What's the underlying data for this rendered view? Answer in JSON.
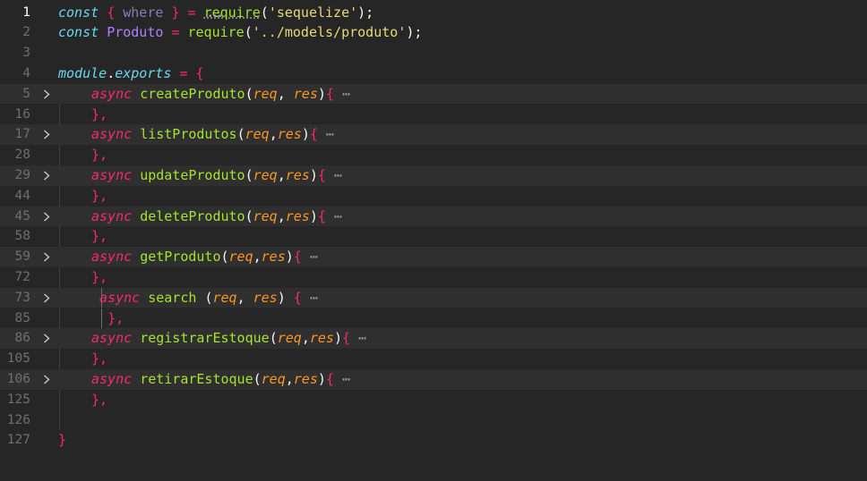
{
  "editor": {
    "lines": [
      {
        "num": "1",
        "current": true,
        "fold": false,
        "indent": 0,
        "tokens": [
          {
            "t": "const",
            "c": "t-kw"
          },
          {
            "t": " ",
            "c": "t-plain"
          },
          {
            "t": "{",
            "c": "t-brace"
          },
          {
            "t": " ",
            "c": "t-plain"
          },
          {
            "t": "where",
            "c": "t-faded"
          },
          {
            "t": " ",
            "c": "t-plain"
          },
          {
            "t": "}",
            "c": "t-brace"
          },
          {
            "t": " ",
            "c": "t-plain"
          },
          {
            "t": "=",
            "c": "t-punc"
          },
          {
            "t": " ",
            "c": "t-plain"
          },
          {
            "t": "require",
            "c": "t-fn"
          },
          {
            "t": "(",
            "c": "t-paren"
          },
          {
            "t": "'",
            "c": "t-str"
          },
          {
            "t": "sequelize",
            "c": "t-str"
          },
          {
            "t": "'",
            "c": "t-str"
          },
          {
            "t": ");",
            "c": "t-paren"
          }
        ]
      },
      {
        "num": "2",
        "fold": false,
        "indent": 0,
        "tokens": [
          {
            "t": "const",
            "c": "t-kw"
          },
          {
            "t": " ",
            "c": "t-plain"
          },
          {
            "t": "Produto",
            "c": "t-var"
          },
          {
            "t": " ",
            "c": "t-plain"
          },
          {
            "t": "=",
            "c": "t-punc"
          },
          {
            "t": " ",
            "c": "t-plain"
          },
          {
            "t": "require",
            "c": "t-fn"
          },
          {
            "t": "(",
            "c": "t-paren"
          },
          {
            "t": "'",
            "c": "t-str"
          },
          {
            "t": "../models/produto",
            "c": "t-str"
          },
          {
            "t": "'",
            "c": "t-str"
          },
          {
            "t": ");",
            "c": "t-paren"
          }
        ]
      },
      {
        "num": "3",
        "fold": false,
        "indent": 0,
        "tokens": []
      },
      {
        "num": "4",
        "fold": false,
        "indent": 0,
        "tokens": [
          {
            "t": "module",
            "c": "t-mod"
          },
          {
            "t": ".",
            "c": "t-plain"
          },
          {
            "t": "exports",
            "c": "t-prop"
          },
          {
            "t": " ",
            "c": "t-plain"
          },
          {
            "t": "=",
            "c": "t-punc"
          },
          {
            "t": " ",
            "c": "t-plain"
          },
          {
            "t": "{",
            "c": "t-brace"
          }
        ]
      },
      {
        "num": "5",
        "fold": true,
        "indent": 1,
        "tokens": [
          {
            "t": "async",
            "c": "t-async"
          },
          {
            "t": " ",
            "c": "t-plain"
          },
          {
            "t": "createProduto",
            "c": "t-fn"
          },
          {
            "t": "(",
            "c": "t-paren"
          },
          {
            "t": "req",
            "c": "t-param"
          },
          {
            "t": ", ",
            "c": "t-plain"
          },
          {
            "t": "res",
            "c": "t-param"
          },
          {
            "t": ")",
            "c": "t-paren"
          },
          {
            "t": "{",
            "c": "t-brace"
          },
          {
            "t": " ⋯",
            "c": "t-ellipsis"
          }
        ]
      },
      {
        "num": "16",
        "fold": false,
        "indent": 1,
        "tokens": [
          {
            "t": "},",
            "c": "t-brace"
          }
        ]
      },
      {
        "num": "17",
        "fold": true,
        "indent": 1,
        "tokens": [
          {
            "t": "async",
            "c": "t-async"
          },
          {
            "t": " ",
            "c": "t-plain"
          },
          {
            "t": "listProdutos",
            "c": "t-fn"
          },
          {
            "t": "(",
            "c": "t-paren"
          },
          {
            "t": "req",
            "c": "t-param"
          },
          {
            "t": ",",
            "c": "t-plain"
          },
          {
            "t": "res",
            "c": "t-param"
          },
          {
            "t": ")",
            "c": "t-paren"
          },
          {
            "t": "{",
            "c": "t-brace"
          },
          {
            "t": " ⋯",
            "c": "t-ellipsis"
          }
        ]
      },
      {
        "num": "28",
        "fold": false,
        "indent": 1,
        "tokens": [
          {
            "t": "},",
            "c": "t-brace"
          }
        ]
      },
      {
        "num": "29",
        "fold": true,
        "indent": 1,
        "tokens": [
          {
            "t": "async",
            "c": "t-async"
          },
          {
            "t": " ",
            "c": "t-plain"
          },
          {
            "t": "updateProduto",
            "c": "t-fn"
          },
          {
            "t": "(",
            "c": "t-paren"
          },
          {
            "t": "req",
            "c": "t-param"
          },
          {
            "t": ",",
            "c": "t-plain"
          },
          {
            "t": "res",
            "c": "t-param"
          },
          {
            "t": ")",
            "c": "t-paren"
          },
          {
            "t": "{",
            "c": "t-brace"
          },
          {
            "t": " ⋯",
            "c": "t-ellipsis"
          }
        ]
      },
      {
        "num": "44",
        "fold": false,
        "indent": 1,
        "tokens": [
          {
            "t": "},",
            "c": "t-brace"
          }
        ]
      },
      {
        "num": "45",
        "fold": true,
        "indent": 1,
        "tokens": [
          {
            "t": "async",
            "c": "t-async"
          },
          {
            "t": " ",
            "c": "t-plain"
          },
          {
            "t": "deleteProduto",
            "c": "t-fn"
          },
          {
            "t": "(",
            "c": "t-paren"
          },
          {
            "t": "req",
            "c": "t-param"
          },
          {
            "t": ",",
            "c": "t-plain"
          },
          {
            "t": "res",
            "c": "t-param"
          },
          {
            "t": ")",
            "c": "t-paren"
          },
          {
            "t": "{",
            "c": "t-brace"
          },
          {
            "t": " ⋯",
            "c": "t-ellipsis"
          }
        ]
      },
      {
        "num": "58",
        "fold": false,
        "indent": 1,
        "tokens": [
          {
            "t": "},",
            "c": "t-brace"
          }
        ]
      },
      {
        "num": "59",
        "fold": true,
        "indent": 1,
        "tokens": [
          {
            "t": "async",
            "c": "t-async"
          },
          {
            "t": " ",
            "c": "t-plain"
          },
          {
            "t": "getProduto",
            "c": "t-fn"
          },
          {
            "t": "(",
            "c": "t-paren"
          },
          {
            "t": "req",
            "c": "t-param"
          },
          {
            "t": ",",
            "c": "t-plain"
          },
          {
            "t": "res",
            "c": "t-param"
          },
          {
            "t": ")",
            "c": "t-paren"
          },
          {
            "t": "{",
            "c": "t-brace"
          },
          {
            "t": " ⋯",
            "c": "t-ellipsis"
          }
        ]
      },
      {
        "num": "72",
        "fold": false,
        "indent": 1,
        "tokens": [
          {
            "t": "},",
            "c": "t-brace"
          }
        ]
      },
      {
        "num": "73",
        "fold": true,
        "indent": 1,
        "extra": true,
        "tokens": [
          {
            "t": " ",
            "c": "t-plain"
          },
          {
            "t": "async",
            "c": "t-async"
          },
          {
            "t": " ",
            "c": "t-plain"
          },
          {
            "t": "search",
            "c": "t-fn"
          },
          {
            "t": " ",
            "c": "t-plain"
          },
          {
            "t": "(",
            "c": "t-paren"
          },
          {
            "t": "req",
            "c": "t-param"
          },
          {
            "t": ", ",
            "c": "t-plain"
          },
          {
            "t": "res",
            "c": "t-param"
          },
          {
            "t": ")",
            "c": "t-paren"
          },
          {
            "t": " ",
            "c": "t-plain"
          },
          {
            "t": "{",
            "c": "t-brace"
          },
          {
            "t": " ⋯",
            "c": "t-ellipsis"
          }
        ]
      },
      {
        "num": "85",
        "fold": false,
        "indent": 1,
        "extra": true,
        "tokens": [
          {
            "t": "  ",
            "c": "t-plain"
          },
          {
            "t": "},",
            "c": "t-brace"
          }
        ]
      },
      {
        "num": "86",
        "fold": true,
        "indent": 1,
        "tokens": [
          {
            "t": "async",
            "c": "t-async"
          },
          {
            "t": " ",
            "c": "t-plain"
          },
          {
            "t": "registrarEstoque",
            "c": "t-fn"
          },
          {
            "t": "(",
            "c": "t-paren"
          },
          {
            "t": "req",
            "c": "t-param"
          },
          {
            "t": ",",
            "c": "t-plain"
          },
          {
            "t": "res",
            "c": "t-param"
          },
          {
            "t": ")",
            "c": "t-paren"
          },
          {
            "t": "{",
            "c": "t-brace"
          },
          {
            "t": " ⋯",
            "c": "t-ellipsis"
          }
        ]
      },
      {
        "num": "105",
        "fold": false,
        "indent": 1,
        "tokens": [
          {
            "t": "},",
            "c": "t-brace"
          }
        ]
      },
      {
        "num": "106",
        "fold": true,
        "indent": 1,
        "tokens": [
          {
            "t": "async",
            "c": "t-async"
          },
          {
            "t": " ",
            "c": "t-plain"
          },
          {
            "t": "retirarEstoque",
            "c": "t-fn"
          },
          {
            "t": "(",
            "c": "t-paren"
          },
          {
            "t": "req",
            "c": "t-param"
          },
          {
            "t": ",",
            "c": "t-plain"
          },
          {
            "t": "res",
            "c": "t-param"
          },
          {
            "t": ")",
            "c": "t-paren"
          },
          {
            "t": "{",
            "c": "t-brace"
          },
          {
            "t": " ⋯",
            "c": "t-ellipsis"
          }
        ]
      },
      {
        "num": "125",
        "fold": false,
        "indent": 1,
        "tokens": [
          {
            "t": "},",
            "c": "t-brace"
          }
        ]
      },
      {
        "num": "126",
        "fold": false,
        "indent": 0,
        "tokens": []
      },
      {
        "num": "127",
        "fold": false,
        "indent": 0,
        "tokens": [
          {
            "t": "}",
            "c": "t-brace"
          }
        ]
      }
    ],
    "fold_icon": "chevron-right-icon",
    "colors": {
      "background": "#262626",
      "folded_line": "#2f2f2f",
      "keyword": "#66d9ef",
      "function": "#a6e22e",
      "string": "#e6db74",
      "parameter": "#fd971f",
      "operator": "#f92672"
    }
  }
}
